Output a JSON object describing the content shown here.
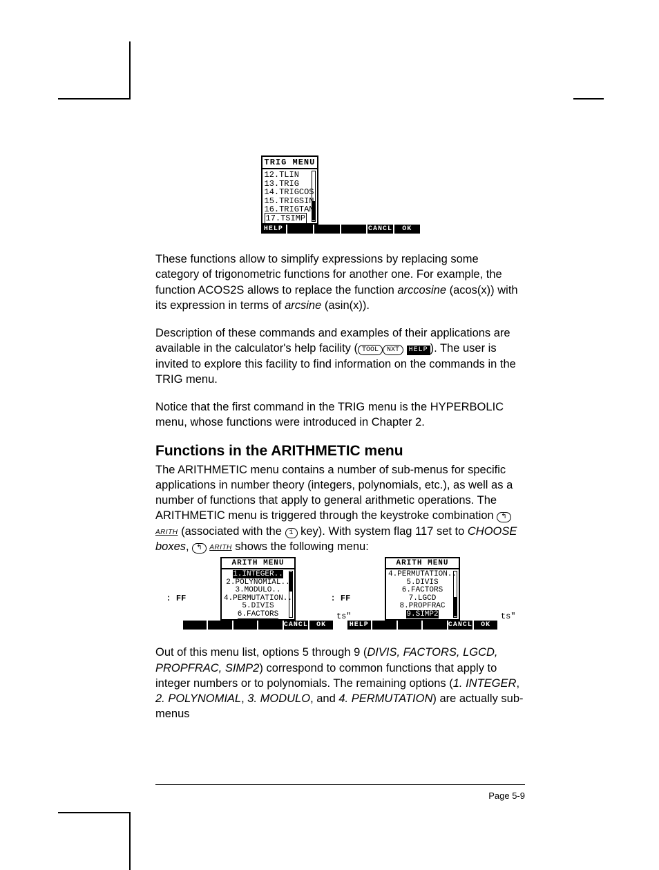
{
  "fig1": {
    "title": "TRIG MENU",
    "items": [
      "12.TLIN",
      "13.TRIG",
      "14.TRIGCOS",
      "15.TRIGSIN",
      "16.TRIGTAN",
      "17.TSIMP"
    ],
    "sk": [
      "HELP",
      "",
      "",
      "",
      "CANCL",
      "OK"
    ]
  },
  "keys": {
    "tool": "TOOL",
    "nxt": "NXT",
    "help": "HELP",
    "lshift": "↰",
    "arith": "ARITH",
    "one": "1"
  },
  "p1a": "These functions allow to simplify expressions by replacing some category of trigonometric functions for another one.  For example, the function ACOS2S allows to replace the function ",
  "p1_arccosine": "arccosine",
  "p1b": " (acos(x)) with its expression in terms of ",
  "p1_arcsine": "arcsine",
  "p1c": " (asin(x)).",
  "p2a": "Description of these commands and examples of their applications are available in the calculator's help facility (",
  "p2b": ").  The user is invited to explore this facility to find information on the commands in the TRIG menu.",
  "p3": "Notice that the first command in the TRIG menu is the HYPERBOLIC menu, whose functions were introduced in Chapter 2.",
  "h2": "Functions in the ARITHMETIC menu",
  "p4a": "The ARITHMETIC menu contains a number of sub-menus for specific applications in number theory (integers, polynomials, etc.), as well as a number of functions that apply to general arithmetic operations.   The ARITHMETIC menu is triggered through the keystroke combination ",
  "p4b": " (associated with the ",
  "p4c": " key).    With system flag 117 set to ",
  "p4_choose": "CHOOSE boxes",
  "p4d": ", ",
  "p4e": "  shows the following menu:",
  "figL": {
    "title": "ARITH MENU",
    "items": [
      "1.INTEGER..",
      "2.POLYNOMIAL..",
      "3.MODULO..",
      "4.PERMUTATION..",
      "5.DIVIS",
      "6.FACTORS"
    ],
    "sk": [
      "",
      "",
      "",
      "",
      "CANCL",
      "OK"
    ]
  },
  "figR": {
    "title": "ARITH MENU",
    "items": [
      "4.PERMUTATION..",
      "5.DIVIS",
      "6.FACTORS",
      "7.LGCD",
      "8.PROPFRAC",
      "9.SIMP2"
    ],
    "sk": [
      "HELP",
      "",
      "",
      "",
      "CANCL",
      "OK"
    ]
  },
  "side": {
    "ff": ": FF",
    "ts": "ts\""
  },
  "p5a": "Out of this menu list, options 5 through 9 (",
  "p5_i1": "DIVIS, FACTORS, LGCD, PROPFRAC, SIMP2",
  "p5b": ") correspond to common functions that apply to integer numbers or to polynomials.   The remaining options (",
  "p5_i2": "1. INTEGER",
  "p5c": ", ",
  "p5_i3": "2. POLYNOMIAL",
  "p5d": ", ",
  "p5_i4": "3. MODULO",
  "p5e": ", and ",
  "p5_i5": "4. PERMUTATION",
  "p5f": ") are actually sub-menus",
  "page_num": "Page 5-9"
}
